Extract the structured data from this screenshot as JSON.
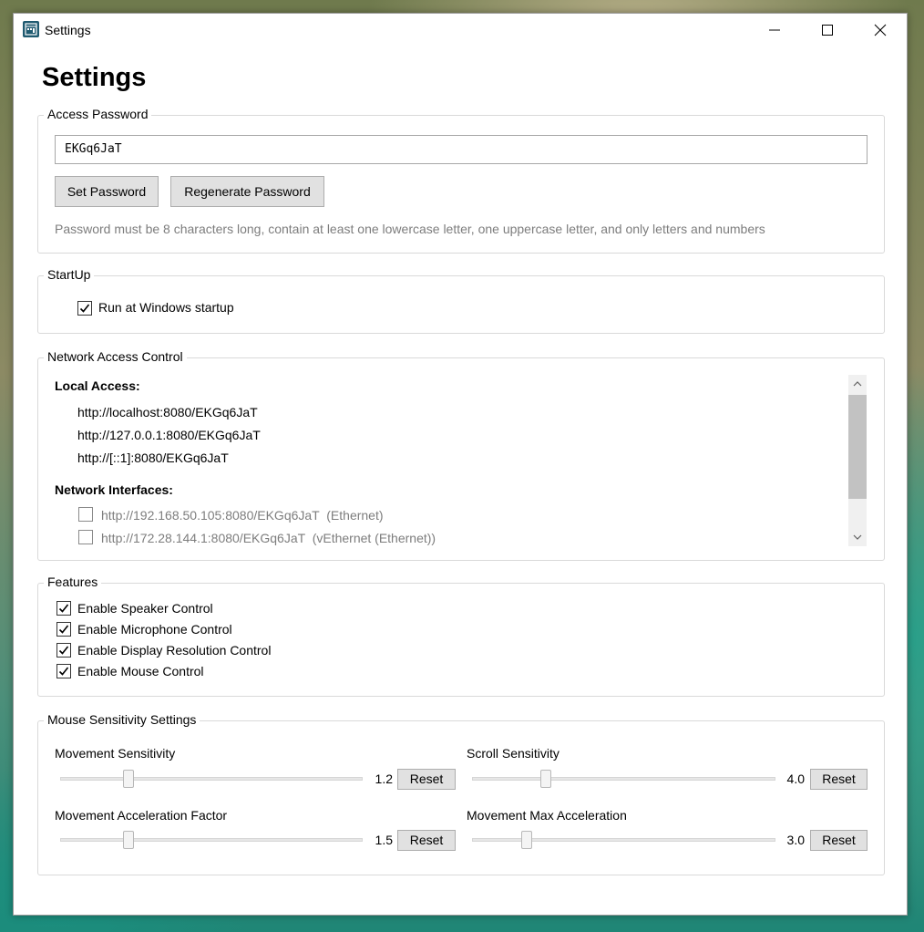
{
  "window": {
    "title": "Settings"
  },
  "page_title": "Settings",
  "access_password": {
    "legend": "Access Password",
    "value": "EKGq6JaT",
    "set_label": "Set Password",
    "regenerate_label": "Regenerate Password",
    "hint": "Password must be 8 characters long, contain at least one lowercase letter, one uppercase letter, and only letters and numbers"
  },
  "startup": {
    "legend": "StartUp",
    "run_at_startup": {
      "label": "Run at Windows startup",
      "checked": true
    }
  },
  "network": {
    "legend": "Network Access Control",
    "local_heading": "Local Access:",
    "local_urls": [
      "http://localhost:8080/EKGq6JaT",
      "http://127.0.0.1:8080/EKGq6JaT",
      "http://[::1]:8080/EKGq6JaT"
    ],
    "interfaces_heading": "Network Interfaces:",
    "interfaces": [
      {
        "label": "http://192.168.50.105:8080/EKGq6JaT  (Ethernet)",
        "checked": false
      },
      {
        "label": "http://172.28.144.1:8080/EKGq6JaT  (vEthernet (Ethernet))",
        "checked": false
      }
    ]
  },
  "features": {
    "legend": "Features",
    "items": [
      {
        "label": "Enable Speaker Control",
        "checked": true
      },
      {
        "label": "Enable Microphone Control",
        "checked": true
      },
      {
        "label": "Enable Display Resolution Control",
        "checked": true
      },
      {
        "label": "Enable Mouse Control",
        "checked": true
      }
    ]
  },
  "mouse": {
    "legend": "Mouse Sensitivity Settings",
    "reset_label": "Reset",
    "sliders": [
      {
        "label": "Movement Sensitivity",
        "value": "1.2"
      },
      {
        "label": "Scroll Sensitivity",
        "value": "4.0"
      },
      {
        "label": "Movement Acceleration Factor",
        "value": "1.5"
      },
      {
        "label": "Movement Max Acceleration",
        "value": "3.0"
      }
    ]
  }
}
